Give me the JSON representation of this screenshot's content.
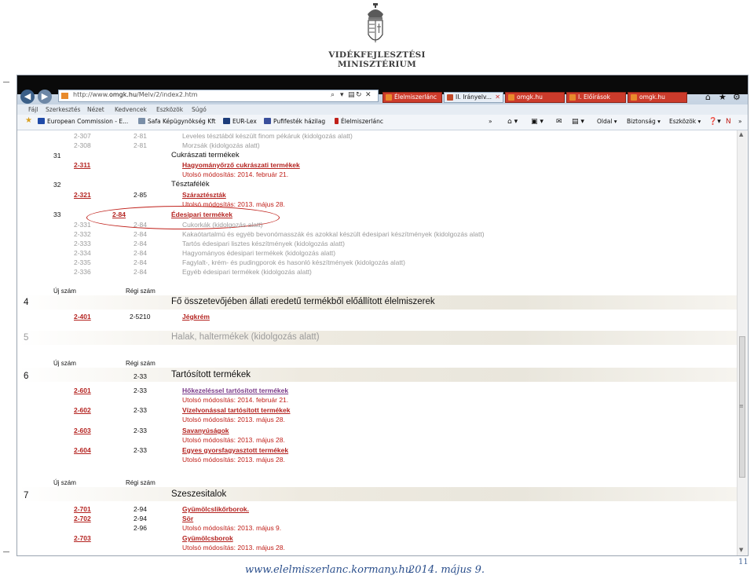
{
  "ministry": {
    "line1": "VIDÉKFEJLESZTÉSI",
    "line2": "MINISZTÉRIUM"
  },
  "browser": {
    "address_prefix": "http://www.",
    "address_host": "omgk.hu",
    "address_path": "/Melv/2/index2.htm",
    "tabs": [
      "Élelmiszerlánc",
      "II. Irányelv...",
      "omgk.hu",
      "I. Előírások",
      "omgk.hu"
    ],
    "menu": [
      "Fájl",
      "Szerkesztés",
      "Nézet",
      "Kedvencek",
      "Eszközök",
      "Súgó"
    ],
    "favorites": [
      "European Commission - E...",
      "Safa Képügynökség Kft",
      "EUR-Lex",
      "Pufifesték házilag",
      "Élelmiszerlánc"
    ],
    "commands": [
      "Oldal ▾",
      "Biztonság ▾",
      "Eszközök ▾"
    ],
    "colors": {
      "accent": "#c0201a",
      "tab_red": "#cc3b2b",
      "link_blue": "#2b4f8c"
    }
  },
  "content": {
    "gray_rows_top": [
      {
        "new": "2-307",
        "old": "2-81",
        "text": "Leveles tésztából készült finom pékáruk (kidolgozás alatt)"
      },
      {
        "new": "2-308",
        "old": "2-81",
        "text": "Morzsák (kidolgozás alatt)"
      }
    ],
    "section31": {
      "num": "31",
      "title": "Cukrászati termékek",
      "link_new": "2-311",
      "link_text": "Hagyományőrző cukrászati termékek",
      "modified": "Utolsó módosítás: 2014. február 21."
    },
    "section32": {
      "num": "32",
      "title": "Tésztafélék",
      "link_new": "2-321",
      "link_old": "2-85",
      "link_text": "Száraztészták",
      "modified": "Utolsó módosítás: 2013. május 28."
    },
    "section33": {
      "num": "33",
      "old": "2-84",
      "title": "Édesipari termékek"
    },
    "gray_rows_33": [
      {
        "new": "2-331",
        "old": "2-84",
        "text": "Cukorkák (kidolgozás alatt)"
      },
      {
        "new": "2-332",
        "old": "2-84",
        "text": "Kakaótartalmú és egyéb bevonómasszák és azokkal készült édesipari   készítmények (kidolgozás alatt)"
      },
      {
        "new": "2-333",
        "old": "2-84",
        "text": "Tartós édesipari lisztes készítmények (kidolgozás alatt)"
      },
      {
        "new": "2-334",
        "old": "2-84",
        "text": "Hagyományos édesipari termékek (kidolgozás alatt)"
      },
      {
        "new": "2-335",
        "old": "2-84",
        "text": "Fagylalt-, krém- és pudingporok és hasonló készítmények (kidolgozás alatt)"
      },
      {
        "new": "2-336",
        "old": "2-84",
        "text": "Egyéb édesipari termékek (kidolgozás alatt)"
      }
    ],
    "col_new": "Új szám",
    "col_old": "Régi szám",
    "chapter4": {
      "num": "4",
      "title": "Fő összetevőjében állati eredetű termékből előállított élelmiszerek",
      "link_new": "2-401",
      "link_old": "2-5210",
      "link_text": "Jégkrém"
    },
    "chapter5": {
      "num": "5",
      "title": "Halak, haltermékek (kidolgozás alatt)"
    },
    "chapter6": {
      "num": "6",
      "old": "2-33",
      "title": "Tartósított termékek",
      "items": [
        {
          "new": "2-601",
          "old": "2-33",
          "text": "Hőkezeléssel tartósított termékek",
          "modified": "Utolsó módosítás: 2014. február 21."
        },
        {
          "new": "2-602",
          "old": "2-33",
          "text": "Vízelvonással tartósított termékek",
          "modified": "Utolsó módosítás: 2013. május 28."
        },
        {
          "new": "2-603",
          "old": "2-33",
          "text": "Savanyúságok",
          "modified": "Utolsó módosítás: 2013. május 28."
        },
        {
          "new": "2-604",
          "old": "2-33",
          "text": "Egyes gyorsfagyasztott termékek",
          "modified": "Utolsó módosítás: 2013. május 28."
        }
      ]
    },
    "chapter7": {
      "num": "7",
      "title": "Szeszesitalok",
      "r1": {
        "new": "2-701",
        "old": "2-94",
        "text": "Gyümölcslikőrborok."
      },
      "r2": {
        "new": "2-702",
        "old": "2-94",
        "text": "Sör"
      },
      "r3": {
        "old": "2-96",
        "modified": "Utolsó módosítás: 2013. május 9."
      },
      "r4": {
        "new": "2-703",
        "text": "Gyümölcsborok",
        "modified": "Utolsó módosítás: 2013. május 28."
      }
    }
  },
  "footer": {
    "url": "www.elelmiszerlanc.kormany.hu",
    "date": "2014. május 9.",
    "page": "11"
  }
}
